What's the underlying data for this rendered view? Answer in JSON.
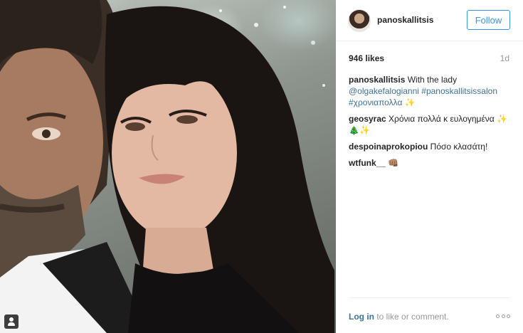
{
  "post": {
    "username": "panoskallitsis",
    "follow_label": "Follow",
    "likes": "946 likes",
    "time_ago": "1d"
  },
  "caption": {
    "user": "panoskallitsis",
    "text": " With the lady ",
    "mention": "@olgakefalogianni",
    "hashtag1": "#panoskallitsissalon",
    "hashtag2": "#χρονιαπολλα",
    "emoji": " ✨"
  },
  "comments": [
    {
      "user": "geosyrac",
      "text": " Χρόνια πολλά κ ευλογημένα ✨🎄✨"
    },
    {
      "user": "despoinaprokopiou",
      "text": " Πόσο κλασάτη!"
    },
    {
      "user": "wtfunk__",
      "text": " 👊🏽"
    }
  ],
  "footer": {
    "login_link": "Log in",
    "login_text": " to like or comment."
  },
  "icons": {
    "tag": "user-tag-icon",
    "more": "more-options-icon"
  },
  "colors": {
    "link": "#3f729b",
    "follow": "#3897f0"
  }
}
